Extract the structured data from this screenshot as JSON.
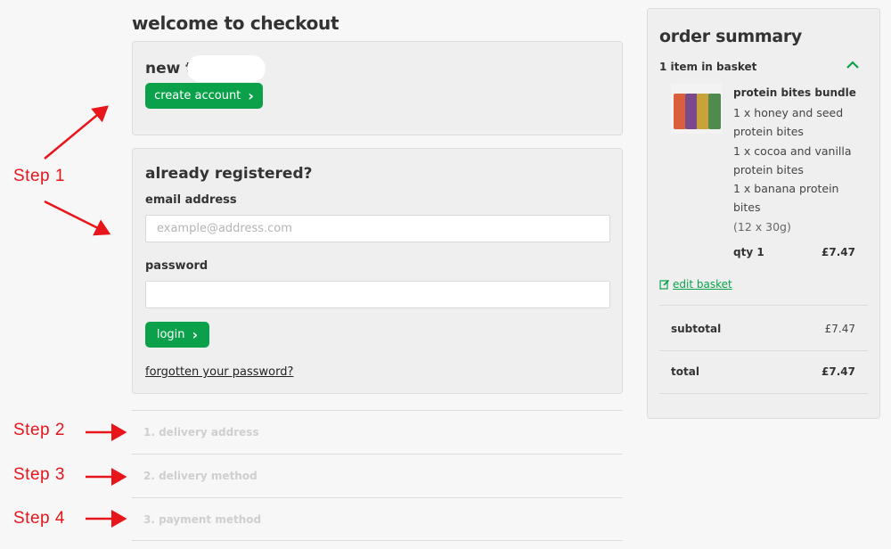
{
  "checkout": {
    "title": "welcome to checkout",
    "new_customer": {
      "heading": "new to",
      "create_account_label": "create account",
      "chevron": "›"
    },
    "registered": {
      "heading": "already registered?",
      "email_label": "email address",
      "email_placeholder": "example@address.com",
      "email_value": "",
      "password_label": "password",
      "password_value": "",
      "login_label": "login",
      "chevron": "›",
      "forgot_link": "forgotten your password?"
    },
    "steps": [
      {
        "label": "1. delivery address"
      },
      {
        "label": "2. delivery method"
      },
      {
        "label": "3. payment method"
      }
    ]
  },
  "annotations": [
    {
      "label": "Step 1"
    },
    {
      "label": "Step 2"
    },
    {
      "label": "Step 3"
    },
    {
      "label": "Step 4"
    }
  ],
  "summary": {
    "title": "order summary",
    "basket_count": "1 item in basket",
    "product": {
      "name": "protein bites bundle",
      "items": [
        "1 x honey and seed protein bites",
        "1 x cocoa and vanilla protein bites",
        "1 x banana protein bites"
      ],
      "pack": "(12 x 30g)",
      "qty": "qty 1",
      "price": "£7.47"
    },
    "edit_basket": "edit basket",
    "subtotal_label": "subtotal",
    "subtotal_value": "£7.47",
    "total_label": "total",
    "total_value": "£7.47"
  },
  "colors": {
    "brand_green": "#0aa14a",
    "annotation_red": "#e8151b",
    "panel_bg": "#efefef",
    "page_bg": "#f7f7f7"
  },
  "icons": {
    "collapse": "chevron-up-icon",
    "edit": "edit-icon",
    "button_arrow": "chevron-right-icon"
  }
}
